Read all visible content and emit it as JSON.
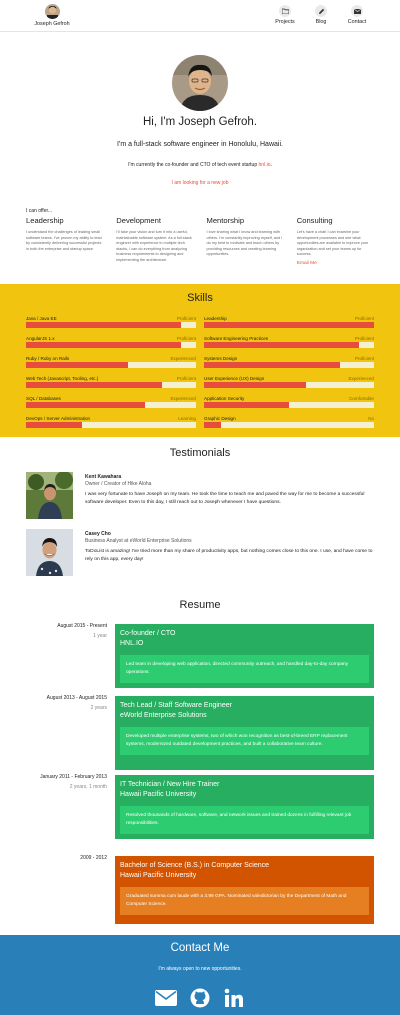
{
  "nav": {
    "brand_name": "Joseph Gefroh",
    "links": [
      {
        "label": "Projects",
        "icon": "folder-icon"
      },
      {
        "label": "Blog",
        "icon": "pencil-icon"
      },
      {
        "label": "Contact",
        "icon": "envelope-icon"
      }
    ]
  },
  "hero": {
    "title": "Hi, I'm Joseph Gefroh.",
    "subtitle": "I'm a full-stack software engineer in Honolulu, Hawaii.",
    "cto_text": "I'm currently the co-founder and CTO of tech event startup",
    "cto_link": "hnl.io",
    "cto_end": ".",
    "hire_text": "I am looking for a new job"
  },
  "offer": {
    "title": "I can offer...",
    "columns": [
      {
        "heading": "Leadership",
        "text": "I understand the challenges of leading small software teams. I've proven my ability to lead by consistently delivering successful projects in both the enterprise and startup space."
      },
      {
        "heading": "Development",
        "text": "I'll take your vision and turn it into a useful, maintainable software system. As a full-stack engineer with experience in multiple tech stacks, I can do everything from analyzing business requirements to designing and implementing the architecture."
      },
      {
        "heading": "Mentorship",
        "text": "I love sharing what I know and learning with others. I'm constantly improving myself, and I do my best to motivate and teach others by providing resources and creating learning opportunities."
      },
      {
        "heading": "Consulting",
        "text": "Let's have a chat! I can examine your development processes and see what opportunities are available to improve your organization and set your teams up for success.",
        "link": "Email Me"
      }
    ]
  },
  "skills": {
    "title": "Skills",
    "left": [
      {
        "name": "Java / Java EE",
        "level": "Proficient",
        "fill": 0.91
      },
      {
        "name": "AngularJS 1.x",
        "level": "Proficient",
        "fill": 0.91
      },
      {
        "name": "Ruby / Ruby on Rails",
        "level": "Experienced",
        "fill": 0.6
      },
      {
        "name": "Web Tech (Javascript, Tooling, etc.)",
        "level": "Proficient",
        "fill": 0.8
      },
      {
        "name": "SQL / Databases",
        "level": "Experienced",
        "fill": 0.7
      },
      {
        "name": "DevOps / Server Administration",
        "level": "Learning",
        "fill": 0.33
      }
    ],
    "right": [
      {
        "name": "Leadership",
        "level": "Proficient",
        "fill": 1.0
      },
      {
        "name": "Software Engineering Practices",
        "level": "Proficient",
        "fill": 0.91
      },
      {
        "name": "Systems Design",
        "level": "Proficient",
        "fill": 0.8
      },
      {
        "name": "User Experience (UX) Design",
        "level": "Experienced",
        "fill": 0.6
      },
      {
        "name": "Application Security",
        "level": "Comfortable",
        "fill": 0.5
      },
      {
        "name": "Graphic Design",
        "level": "No",
        "fill": 0.1
      }
    ]
  },
  "testimonials": {
    "title": "Testimonials",
    "items": [
      {
        "name": "Kent Kawahara",
        "role": "Owner / Creator of Hike Aloha",
        "quote": "I was very fortunate to have Joseph on my team. He took the time to teach me and paved the way for me to become a successful software developer. Even to this day, I still reach out to Joseph whenever I have questions."
      },
      {
        "name": "Casey Cho",
        "role": "Business Analyst at eWorld Enterprise Solutions",
        "quote": "ToDoList is amazing! I've tried more than my share of productivity apps, but nothing comes close to this one. I use, and have come to rely on this app, every day!"
      }
    ]
  },
  "resume": {
    "title": "Resume",
    "items": [
      {
        "dates": "August 2015 - Present",
        "duration": "1 year",
        "role": "Co-founder / CTO",
        "org": "HNL.IO",
        "detail": "Led team in developing web application, directed community outreach, and handled day-to-day company operations.",
        "color": "green"
      },
      {
        "dates": "August 2013 - August 2015",
        "duration": "2 years",
        "role": "Tech Lead / Staff Software Engineer",
        "org": "eWorld Enterprise Solutions",
        "detail": "Developed multiple enterprise systems, two of which won recognition as best-of-breed ERP replacement systems, modernized outdated development practices, and built a collaborative team culture.",
        "color": "green"
      },
      {
        "dates": "January 2011 - February 2013",
        "duration": "2 years, 1 month",
        "role": "IT Technician / New Hire Trainer",
        "org": "Hawaii Pacific University",
        "detail": "Resolved thousands of hardware, software, and network issues and trained dozens in fulfilling relevant job responsibilities.",
        "color": "green"
      },
      {
        "dates": "2009 - 2012",
        "duration": "",
        "role": "Bachelor of Science (B.S.) in Computer Science",
        "org": "Hawaii Pacific University",
        "detail": "Graduated summa cum laude with a 3.99 GPA. Nominated valedictorian by the Department of Math and Computer Science.",
        "color": "orange"
      }
    ]
  },
  "contact": {
    "title": "Contact Me",
    "subtitle": "I'm always open to new opportunities.",
    "icons": [
      "envelope-icon",
      "github-icon",
      "linkedin-icon"
    ]
  },
  "colors": {
    "accent": "#e74c3c",
    "skills_bg": "#f1c40f",
    "resume_green": "#27ae60",
    "resume_orange": "#d35400",
    "contact_bg": "#2980b9"
  }
}
